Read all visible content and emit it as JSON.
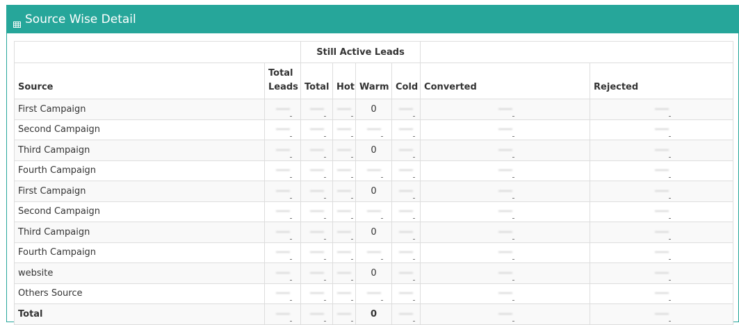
{
  "panel": {
    "title": "Source Wise Detail",
    "icon": "table-icon",
    "header_color": "#26a69a"
  },
  "table": {
    "group_header": "Still Active Leads",
    "columns": {
      "source": "Source",
      "total_leads": "Total Leads",
      "total_leads_line1": "Total",
      "total_leads_line2": "Leads",
      "total": "Total",
      "hot": "Hot",
      "warm": "Warm",
      "cold": "Cold",
      "converted": "Converted",
      "rejected": "Rejected"
    },
    "rows": [
      {
        "source": "First Campaign",
        "warm": "0"
      },
      {
        "source": "Second Campaign",
        "warm": ""
      },
      {
        "source": "Third Campaign",
        "warm": "0"
      },
      {
        "source": "Fourth Campaign",
        "warm": ""
      },
      {
        "source": "First Campaign",
        "warm": "0"
      },
      {
        "source": "Second Campaign",
        "warm": ""
      },
      {
        "source": "Third Campaign",
        "warm": "0"
      },
      {
        "source": "Fourth Campaign",
        "warm": ""
      },
      {
        "source": "website",
        "warm": "0"
      },
      {
        "source": "Others Source",
        "warm": ""
      }
    ],
    "total_row": {
      "source": "Total",
      "warm": "0"
    }
  }
}
